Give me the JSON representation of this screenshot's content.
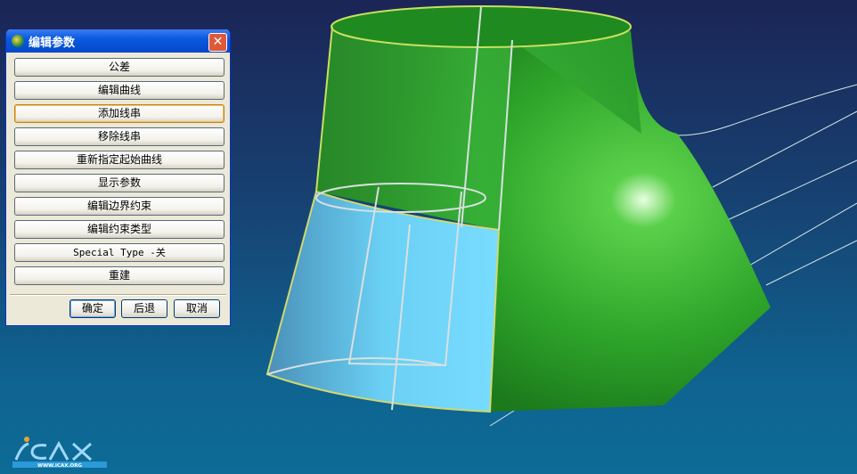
{
  "dialog": {
    "title": "编辑参数",
    "close": "✕",
    "buttons": [
      "公差",
      "编辑曲线",
      "添加线串",
      "移除线串",
      "重新指定起始曲线",
      "显示参数",
      "编辑边界约束",
      "编辑约束类型",
      "Special Type -关",
      "重建"
    ],
    "ok": "确定",
    "back": "后退",
    "cancel": "取消"
  },
  "logo": {
    "text": "ICAX",
    "url": "WWW.ICAX.ORG"
  }
}
